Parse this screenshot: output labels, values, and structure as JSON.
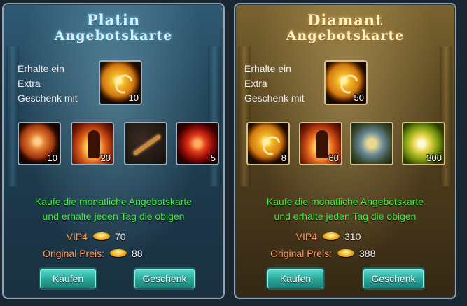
{
  "cards": [
    {
      "title_line1": "Platin",
      "title_line2": "Angebotskarte",
      "extra_text": [
        "Erhalte ein",
        "Extra",
        "Geschenk mit"
      ],
      "bonus_item": {
        "icon": "gold-coin-icon",
        "qty": "10"
      },
      "items": [
        {
          "icon": "bronze-coin-icon",
          "qty": "10"
        },
        {
          "icon": "fire-figure-icon",
          "qty": "20"
        },
        {
          "icon": "key-icon",
          "qty": ""
        },
        {
          "icon": "red-orb-icon",
          "qty": "5"
        }
      ],
      "description": [
        "Kaufe die monatliche Angebotskarte",
        "und erhalte jeden Tag die obigen"
      ],
      "vip_label": "VIP4",
      "vip_price": "70",
      "original_label": "Original Preis:",
      "original_price": "88",
      "buy_label": "Kaufen",
      "gift_label": "Geschenk"
    },
    {
      "title_line1": "Diamant",
      "title_line2": "Angebotskarte",
      "extra_text": [
        "Erhalte ein",
        "Extra",
        "Geschenk mit"
      ],
      "bonus_item": {
        "icon": "gold-coin-icon",
        "qty": "50"
      },
      "items": [
        {
          "icon": "gold-coin-icon",
          "qty": "8"
        },
        {
          "icon": "fire-figure-icon",
          "qty": "60"
        },
        {
          "icon": "chest-icon",
          "qty": ""
        },
        {
          "icon": "lightning-icon",
          "qty": "300"
        }
      ],
      "description": [
        "Kaufe die monatliche Angebotskarte",
        "und erhalte jeden Tag die obigen"
      ],
      "vip_label": "VIP4",
      "vip_price": "310",
      "original_label": "Original Preis:",
      "original_price": "388",
      "buy_label": "Kaufen",
      "gift_label": "Geschenk"
    }
  ]
}
